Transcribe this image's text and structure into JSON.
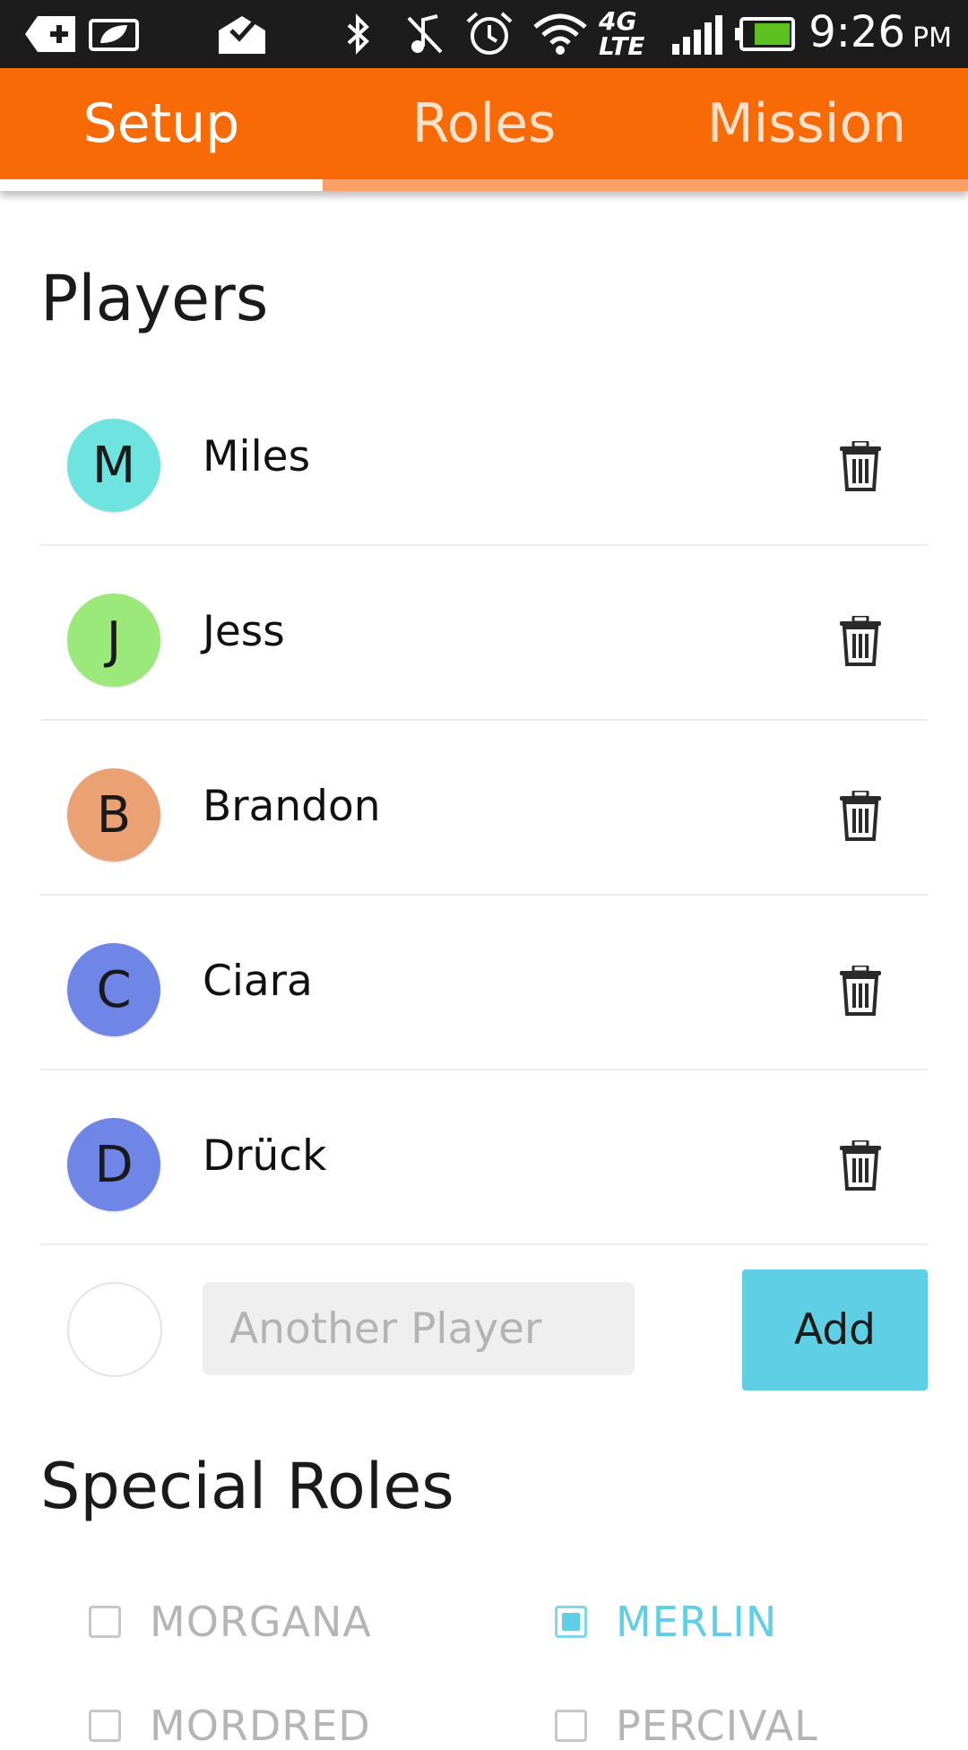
{
  "status_bar": {
    "time": "9:26",
    "ampm": "PM",
    "network_label": "4G LTE",
    "icons": [
      "add-icon",
      "leaf-card-icon",
      "mail-check-icon",
      "bluetooth-icon",
      "mute-icon",
      "alarm-icon",
      "wifi-icon",
      "network-4g-lte-icon",
      "signal-icon",
      "battery-icon"
    ]
  },
  "tabs": [
    {
      "label": "Setup",
      "selected": true
    },
    {
      "label": "Roles",
      "selected": false
    },
    {
      "label": "Mission",
      "selected": false
    }
  ],
  "players_section": {
    "title": "Players",
    "players": [
      {
        "initial": "M",
        "name": "Miles",
        "color": "#6fe3e0"
      },
      {
        "initial": "J",
        "name": "Jess",
        "color": "#9be97a"
      },
      {
        "initial": "B",
        "name": "Brandon",
        "color": "#eaa274"
      },
      {
        "initial": "C",
        "name": "Ciara",
        "color": "#6f86e6"
      },
      {
        "initial": "D",
        "name": "Drück",
        "color": "#6f86e6"
      }
    ],
    "new_player": {
      "placeholder": "Another Player",
      "value": ""
    },
    "add_button_label": "Add"
  },
  "special_roles_section": {
    "title": "Special Roles",
    "roles": [
      {
        "label": "MORGANA",
        "checked": false
      },
      {
        "label": "MERLIN",
        "checked": true
      },
      {
        "label": "MORDRED",
        "checked": false
      },
      {
        "label": "PERCIVAL",
        "checked": false
      }
    ]
  },
  "colors": {
    "accent_orange": "#f76a06",
    "accent_cyan": "#5ecfe4"
  }
}
